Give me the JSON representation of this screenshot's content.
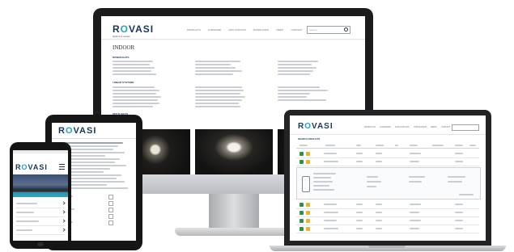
{
  "brand": {
    "name": "ROVASI",
    "tagline": "lighting & design",
    "accent_color": "#1fa3c9",
    "dark_color": "#16365c"
  },
  "desktop": {
    "nav": [
      "PRODUCTS",
      "LUMINAIRE",
      "APPLICATIONS",
      "DOWNLOADS",
      "NEWS",
      "CONTACT"
    ],
    "search_placeholder": "Search",
    "section_title": "INDOOR",
    "group_1": "DOWNLIGHTS",
    "group_2": "LINEAR SYSTEMS",
    "group_3": "SPOTLIGHTS"
  },
  "laptop": {
    "nav": [
      "PRODUCTS",
      "LUMINAIRE",
      "APPLICATIONS",
      "DOWNLOADS",
      "NEWS",
      "CONTACT"
    ],
    "section_title": "SEARCH RESULTS"
  },
  "icons": [
    "search-icon",
    "hamburger-menu-icon",
    "chevron-right-icon",
    "home-button-icon"
  ]
}
